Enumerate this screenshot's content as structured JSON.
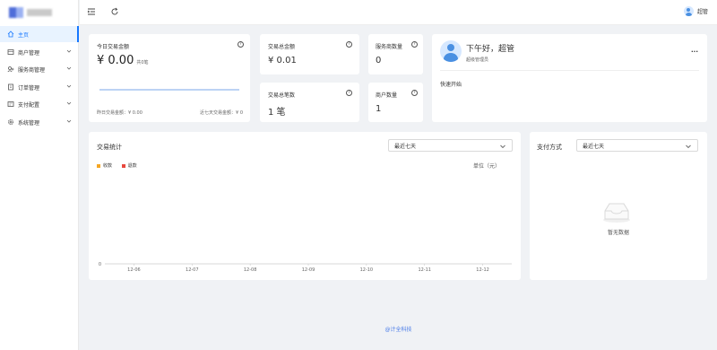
{
  "sidebar": {
    "items": [
      {
        "label": "主页",
        "active": true
      },
      {
        "label": "商户管理"
      },
      {
        "label": "服务商管理"
      },
      {
        "label": "订单管理"
      },
      {
        "label": "支付配置"
      },
      {
        "label": "系统管理"
      }
    ]
  },
  "header": {
    "user_name": "超管"
  },
  "today_card": {
    "title": "今日交易金额",
    "amount": "¥ 0.00",
    "count": "共0笔",
    "yesterday": "昨日交易金额：¥ 0.00",
    "last7": "近七天交易金额：¥ 0"
  },
  "total_amount": {
    "title": "交易总金额",
    "value": "¥ 0.01"
  },
  "total_count": {
    "title": "交易总笔数",
    "value": "1 笔"
  },
  "provider_count": {
    "title": "服务商数量",
    "value": "0"
  },
  "merchant_count": {
    "title": "商户数量",
    "value": "1"
  },
  "welcome": {
    "greeting": "下午好，超管",
    "role": "超级管理员",
    "quick_start": "快速开始",
    "more": "···"
  },
  "stats": {
    "title": "交易统计",
    "range": "最近七天",
    "unit": "单位（元）",
    "legend": [
      {
        "name": "收款",
        "color": "#f5a623"
      },
      {
        "name": "退款",
        "color": "#e8483e"
      }
    ]
  },
  "chart_data": {
    "type": "line",
    "categories": [
      "12-06",
      "12-07",
      "12-08",
      "12-09",
      "12-10",
      "12-11",
      "12-12"
    ],
    "series": [
      {
        "name": "收款",
        "values": [
          0,
          0,
          0,
          0,
          0,
          0,
          0
        ]
      },
      {
        "name": "退款",
        "values": [
          0,
          0,
          0,
          0,
          0,
          0,
          0
        ]
      }
    ],
    "ylabel": "单位（元）",
    "yticks": [
      "0"
    ],
    "ylim": [
      0,
      1
    ],
    "legend_position": "top-left"
  },
  "pay_method": {
    "title": "支付方式",
    "range": "最近七天",
    "empty": "暂无数据"
  },
  "footer": {
    "text": "@计全科技"
  }
}
